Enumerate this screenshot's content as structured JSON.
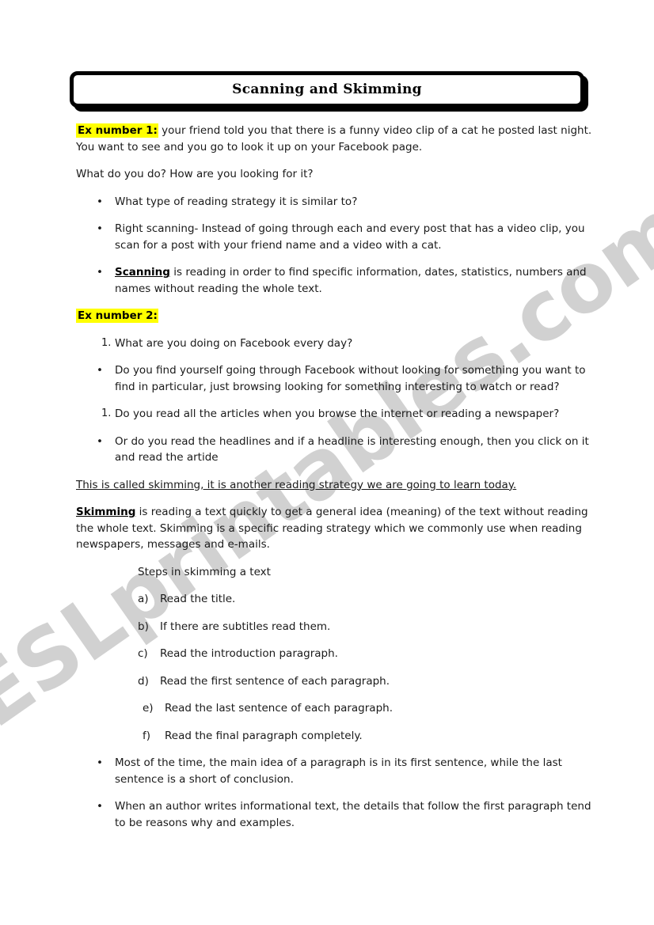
{
  "document": {
    "title": "Scanning and Skimming",
    "watermark": "ESLprintables.com"
  },
  "sections": {
    "ex1": {
      "label": "Ex number 1:",
      "intro": " your friend told you that there is a funny video clip of a cat he posted last night. You want to see and you go to look it up on your Facebook page.",
      "question": "What do you do? How are you looking for it?",
      "bullets": [
        {
          "mark": "•",
          "text": "What type of reading strategy it is similar to?"
        },
        {
          "mark": "•",
          "text": "Right scanning- Instead of going through each and every post that has a video clip, you scan for a post with your friend name and a video with a cat."
        },
        {
          "mark": "•",
          "bold_lead": "Scanning",
          "text": " is reading in order to find specific information, dates, statistics, numbers and names without reading the whole text."
        }
      ]
    },
    "ex2": {
      "label": "Ex number 2:",
      "items": [
        {
          "mark": "1.",
          "type": "number",
          "text": "What are you doing on Facebook every day?"
        },
        {
          "mark": "•",
          "type": "bullet",
          "text": "Do you find yourself going through Facebook without looking for something you want to find in particular, just browsing looking for something interesting to watch or read?"
        },
        {
          "mark": "1.",
          "type": "number",
          "text": "Do you read all the articles when you browse the internet or reading a newspaper?"
        },
        {
          "mark": "•",
          "type": "bullet",
          "text": "Or do you read the headlines and if a headline is interesting enough, then you click on it and read the artide"
        }
      ]
    },
    "skimming": {
      "callout": "This is called skimming, it is another reading strategy we are going to learn today.",
      "definition_lead": "Skimming",
      "definition": " is reading a text quickly to get a general idea (meaning) of the text without reading the whole text. Skimming is a specific reading strategy which we commonly use when reading newspapers, messages and e-mails.",
      "steps_heading": "Steps in skimming a text",
      "steps": [
        {
          "mark": "a)",
          "text": "Read the title."
        },
        {
          "mark": "b)",
          "text": "If there are subtitles read them."
        },
        {
          "mark": "c)",
          "text": "Read the introduction paragraph."
        },
        {
          "mark": "d)",
          "text": "Read the first sentence of each paragraph."
        },
        {
          "mark": "e)",
          "text": "Read the last sentence of each paragraph."
        },
        {
          "mark": "f)",
          "text": "Read the final paragraph completely."
        }
      ],
      "closing_bullets": [
        {
          "mark": "•",
          "text": "Most of the time, the main idea of a paragraph is in its first sentence, while the last sentence is a short of conclusion."
        },
        {
          "mark": "•",
          "text": "When an author writes informational text, the details that follow the first paragraph tend to be reasons why and examples."
        }
      ]
    }
  },
  "colors": {
    "highlight": "#ffff00",
    "text": "#1a1a1a",
    "border": "#000000",
    "watermark": "#c9c9c9"
  }
}
